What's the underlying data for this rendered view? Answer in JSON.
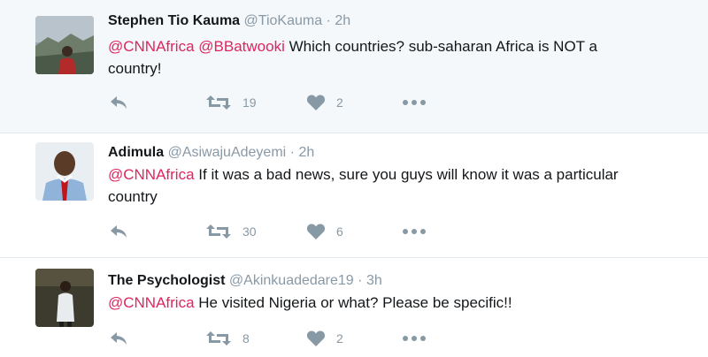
{
  "tweets": [
    {
      "name": "Stephen Tio Kauma",
      "handle": "@TioKauma",
      "separator": "·",
      "time": "2h",
      "mentions": [
        "@CNNAfrica",
        "@BBatwooki"
      ],
      "text_line1_rest": "Which countries? sub-saharan Africa is NOT a",
      "text_line2": "country!",
      "retweets": "19",
      "likes": "2"
    },
    {
      "name": "Adimula",
      "handle": "@AsiwajuAdeyemi",
      "separator": "·",
      "time": "2h",
      "mentions": [
        "@CNNAfrica"
      ],
      "text_line1_rest": "If it was a bad news, sure you guys will know it was a particular",
      "text_line2": "country",
      "retweets": "30",
      "likes": "6"
    },
    {
      "name": "The Psychologist",
      "handle": "@Akinkuadedare19",
      "separator": "·",
      "time": "3h",
      "mentions": [
        "@CNNAfrica"
      ],
      "text_line1_rest": "He visited Nigeria or what? Please be specific!!",
      "retweets": "8",
      "likes": "2"
    }
  ],
  "icons": {
    "reply": "reply-icon",
    "retweet": "retweet-icon",
    "like": "heart-icon",
    "more": "more-icon"
  },
  "colors": {
    "mention": "#e0245e",
    "muted": "#8899a6",
    "highlight_bg": "#f5f8fa"
  }
}
